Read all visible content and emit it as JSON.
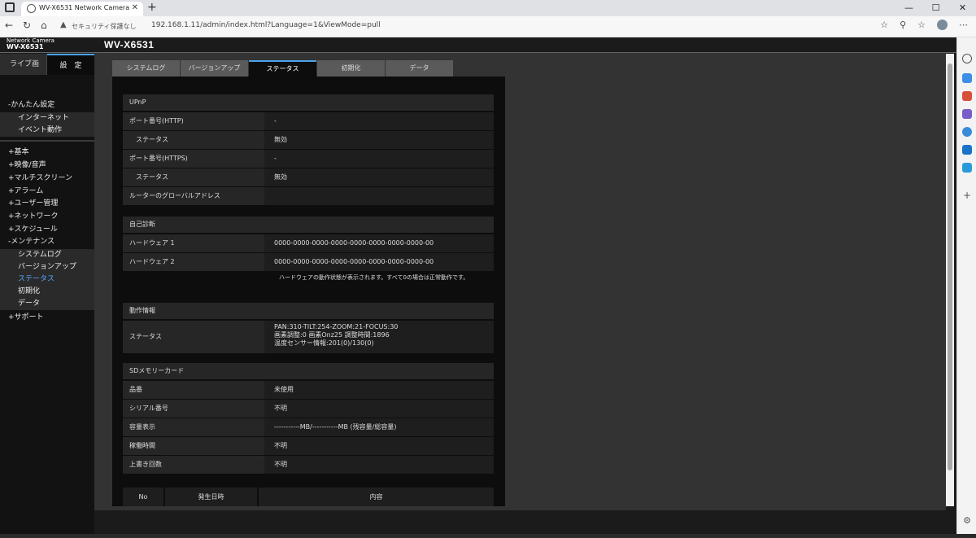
{
  "browser": {
    "tab_title": "WV-X6531 Network Camera",
    "url_security": "セキュリティ保護なし",
    "url": "192.168.1.11/admin/index.html?Language=1&ViewMode=pull"
  },
  "camera": {
    "brand": "Network Camera",
    "model": "WV-X6531",
    "header_title": "WV-X6531",
    "live_label": "ライブ画",
    "setup_label": "設　定"
  },
  "nav": {
    "quick": "-かんたん設定",
    "internet": "インターネット",
    "event": "イベント動作",
    "basic": "+基本",
    "video": "+映像/音声",
    "multiscreen": "+マルチスクリーン",
    "alarm": "+アラーム",
    "user": "+ユーザー管理",
    "network": "+ネットワーク",
    "schedule": "+スケジュール",
    "maintenance": "-メンテナンス",
    "syslog": "システムログ",
    "upgrade": "バージョンアップ",
    "status": "ステータス",
    "reset": "初期化",
    "data": "データ",
    "support": "+サポート"
  },
  "tabs": [
    "システムログ",
    "バージョンアップ",
    "ステータス",
    "初期化",
    "データ"
  ],
  "upnp": {
    "title": "UPnP",
    "http_port_label": "ポート番号(HTTP)",
    "http_port_value": "-",
    "status1_label": "ステータス",
    "status1_value": "無効",
    "https_port_label": "ポート番号(HTTPS)",
    "https_port_value": "-",
    "status2_label": "ステータス",
    "status2_value": "無効",
    "global_label": "ルーターのグローバルアドレス",
    "global_value": ""
  },
  "selfcheck": {
    "title": "自己診断",
    "hw1_label": "ハードウェア 1",
    "hw1_value": "0000-0000-0000-0000-0000-0000-0000-0000-00",
    "hw2_label": "ハードウェア 2",
    "hw2_value": "0000-0000-0000-0000-0000-0000-0000-0000-00",
    "note": "ハードウェアの動作状態が表示されます。すべて0の場合は正常動作です。"
  },
  "operation": {
    "title": "動作情報",
    "status_label": "ステータス",
    "line1": "PAN:310-TILT:254-ZOOM:21-FOCUS:30",
    "line2": "画素調整:0 画素Onz25 調整時間:1896",
    "line3": "温度センサー情報:201(0)/130(0)"
  },
  "sd": {
    "title": "SDメモリーカード",
    "product_label": "品番",
    "product_value": "未使用",
    "serial_label": "シリアル番号",
    "serial_value": "不明",
    "capacity_label": "容量表示",
    "capacity_value": "-----------MB/-----------MB (残容量/総容量)",
    "usage_label": "稼働時間",
    "usage_value": "不明",
    "overwrite_label": "上書き回数",
    "overwrite_value": "不明"
  },
  "log_table": {
    "headers": [
      "No",
      "発生日時",
      "内容"
    ]
  }
}
